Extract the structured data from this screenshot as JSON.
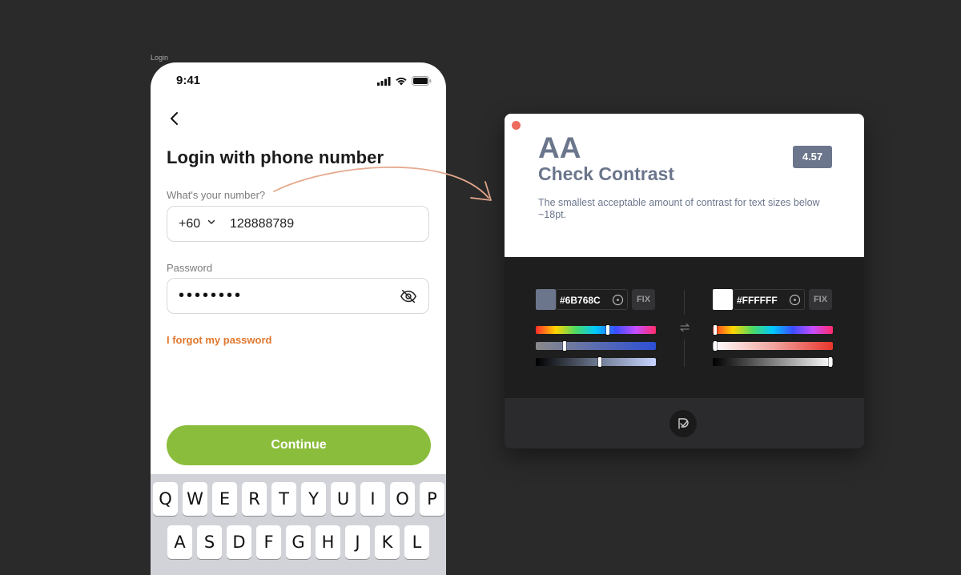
{
  "frame_label": "Login",
  "phone": {
    "status_time": "9:41",
    "title": "Login with phone number",
    "number_label": "What's your number?",
    "country_code": "+60",
    "phone_number": "128888789",
    "password_label": "Password",
    "password_masked": "••••••••",
    "forgot_link": "I forgot my password",
    "continue_label": "Continue",
    "keyboard": {
      "row1": [
        "Q",
        "W",
        "E",
        "R",
        "T",
        "Y",
        "U",
        "I",
        "O",
        "P"
      ],
      "row2": [
        "A",
        "S",
        "D",
        "F",
        "G",
        "H",
        "J",
        "K",
        "L"
      ]
    }
  },
  "contrast": {
    "level": "AA",
    "title": "Check Contrast",
    "ratio": "4.57",
    "description": "The smallest acceptable amount of contrast for text sizes below ~18pt.",
    "foreground": {
      "hex": "#6B768C",
      "fix_label": "FIX",
      "hue": 0.6,
      "saturation": 0.24,
      "lightness": 0.53
    },
    "background": {
      "hex": "#FFFFFF",
      "fix_label": "FIX",
      "hue": 0.01,
      "saturation": 0.01,
      "lightness": 0.99
    }
  },
  "colors": {
    "accent_green": "#8bbd3c",
    "link_orange": "#e0782f",
    "panel_text": "#6b768c",
    "close_red": "#ec6a5e"
  },
  "icons": {
    "back": "chevron-left-icon",
    "eye": "eye-off-icon",
    "picker": "eyedropper-icon",
    "swap": "swap-icon",
    "plugin": "plugin-logo-icon"
  }
}
